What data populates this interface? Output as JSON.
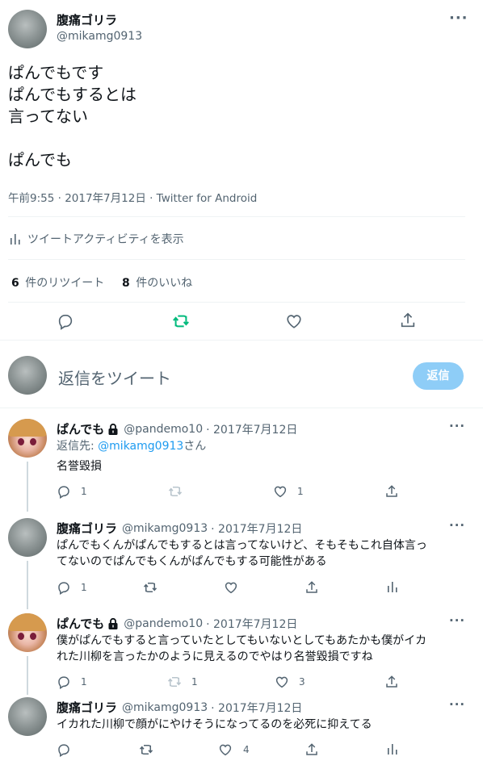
{
  "main_tweet": {
    "author_name": "腹痛ゴリラ",
    "author_handle": "@mikamg0913",
    "text": "ぱんでもです\nぱんでもするとは\n言ってない\n\nぱんでも",
    "timestamp": "午前9:55 · 2017年7月12日 · Twitter for Android",
    "activity_label": "ツイートアクティビティを表示",
    "retweet_count": "6",
    "retweet_label": "件のリツイート",
    "like_count": "8",
    "like_label": "件のいいね"
  },
  "compose": {
    "placeholder": "返信をツイート",
    "reply_button": "返信"
  },
  "replies": [
    {
      "author_name": "ぱんでも",
      "locked": true,
      "author_handle": "@pandemo10",
      "date": "· 2017年7月12日",
      "reply_to_prefix": "返信先: ",
      "reply_to_handle": "@mikamg0913",
      "reply_to_suffix": "さん",
      "text": "名誉毀損",
      "reply_count": "1",
      "retweet_count": "",
      "like_count": "1"
    },
    {
      "author_name": "腹痛ゴリラ",
      "locked": false,
      "author_handle": "@mikamg0913",
      "date": "· 2017年7月12日",
      "text_line1": "ぱんでもくんがぱんでもするとは言ってないけど、そもそもこれ自体言っ",
      "text_line2": "てないのでぱんでもくんがぱんでもする可能性がある",
      "reply_count": "1",
      "retweet_count": "",
      "like_count": ""
    },
    {
      "author_name": "ぱんでも",
      "locked": true,
      "author_handle": "@pandemo10",
      "date": "· 2017年7月12日",
      "text_line1": "僕がぱんでもすると言っていたとしてもいないとしてもあたかも僕がイカ",
      "text_line2": "れた川柳を言ったかのように見えるのでやはり名誉毀損ですね",
      "reply_count": "1",
      "retweet_count": "1",
      "like_count": "3"
    },
    {
      "author_name": "腹痛ゴリラ",
      "locked": false,
      "author_handle": "@mikamg0913",
      "date": "· 2017年7月12日",
      "text": "イカれた川柳で顔がにやけそうになってるのを必死に抑えてる",
      "reply_count": "",
      "retweet_count": "",
      "like_count": "4"
    }
  ],
  "colors": {
    "retweet_active": "#00ba7c",
    "link": "#1d9bf0",
    "reply_button_disabled": "#8ecdf7"
  }
}
